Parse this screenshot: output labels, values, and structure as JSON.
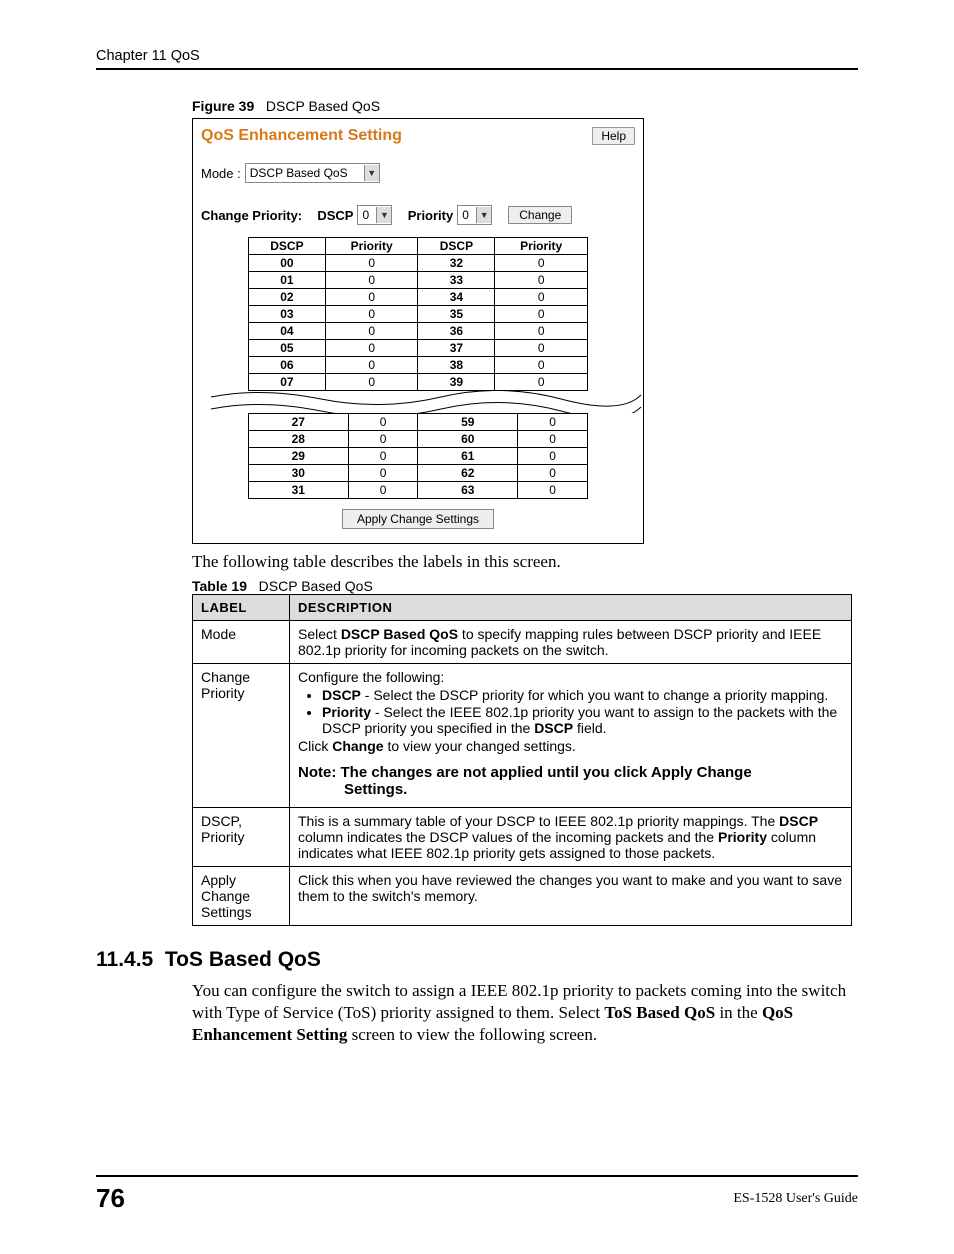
{
  "header": {
    "chapter": "Chapter 11 QoS"
  },
  "figure": {
    "label": "Figure 39",
    "title": "DSCP Based QoS"
  },
  "ui": {
    "title": "QoS Enhancement Setting",
    "help": "Help",
    "mode_label": "Mode :",
    "mode_value": "DSCP Based QoS",
    "change_priority_label": "Change Priority:",
    "dscp_label": "DSCP",
    "dscp_value": "0",
    "priority_label": "Priority",
    "priority_value": "0",
    "change_btn": "Change",
    "apply_btn": "Apply Change Settings",
    "headers": [
      "DSCP",
      "Priority",
      "DSCP",
      "Priority"
    ],
    "rows_top": [
      [
        "00",
        "0",
        "32",
        "0"
      ],
      [
        "01",
        "0",
        "33",
        "0"
      ],
      [
        "02",
        "0",
        "34",
        "0"
      ],
      [
        "03",
        "0",
        "35",
        "0"
      ],
      [
        "04",
        "0",
        "36",
        "0"
      ],
      [
        "05",
        "0",
        "37",
        "0"
      ],
      [
        "06",
        "0",
        "38",
        "0"
      ],
      [
        "07",
        "0",
        "39",
        "0"
      ]
    ],
    "rows_bottom": [
      [
        "27",
        "0",
        "59",
        "0"
      ],
      [
        "28",
        "0",
        "60",
        "0"
      ],
      [
        "29",
        "0",
        "61",
        "0"
      ],
      [
        "30",
        "0",
        "62",
        "0"
      ],
      [
        "31",
        "0",
        "63",
        "0"
      ]
    ]
  },
  "after_fig_text": "The following table describes the labels in this screen.",
  "table_caption": {
    "label": "Table 19",
    "title": "DSCP Based QoS"
  },
  "desc_headers": {
    "label": "LABEL",
    "description": "DESCRIPTION"
  },
  "desc_rows": {
    "r1": {
      "label": "Mode",
      "pre": "Select ",
      "bold": "DSCP Based QoS",
      "post": " to specify mapping rules between DSCP priority and IEEE 802.1p priority for incoming packets on the switch."
    },
    "r2": {
      "label": "Change Priority",
      "intro": "Configure the following:",
      "b1_bold": "DSCP",
      "b1_rest": " - Select the DSCP priority for which you want to change a priority mapping.",
      "b2_bold": "Priority",
      "b2_rest_a": " - Select the IEEE 802.1p priority you want to assign to the packets with the DSCP priority you specified in the ",
      "b2_bold2": "DSCP",
      "b2_rest_b": " field.",
      "click_a": "Click ",
      "click_bold": "Change",
      "click_b": " to view your changed settings.",
      "note_line1": "Note: The changes are not applied until you click Apply Change",
      "note_line2": "Settings."
    },
    "r3": {
      "label": "DSCP, Priority",
      "a": "This is a summary table of your DSCP to IEEE 802.1p priority mappings. The ",
      "b1": "DSCP",
      "b": " column indicates the DSCP values of the incoming packets and the ",
      "b2": "Priority",
      "c": " column indicates what IEEE 802.1p priority gets assigned to those packets."
    },
    "r4": {
      "label": "Apply Change Settings",
      "text": "Click this when you have reviewed the changes you want to make and you want to save them to the switch's memory."
    }
  },
  "section": {
    "number": "11.4.5",
    "title": "ToS Based QoS",
    "para_a": "You can configure the switch to assign a IEEE 802.1p priority to packets coming into the switch with Type of Service (ToS) priority assigned to them. Select ",
    "para_b1": "ToS Based QoS",
    "para_c": " in the ",
    "para_b2": "QoS Enhancement Setting",
    "para_d": " screen to view the following screen."
  },
  "footer": {
    "page": "76",
    "guide": "ES-1528 User's Guide"
  }
}
